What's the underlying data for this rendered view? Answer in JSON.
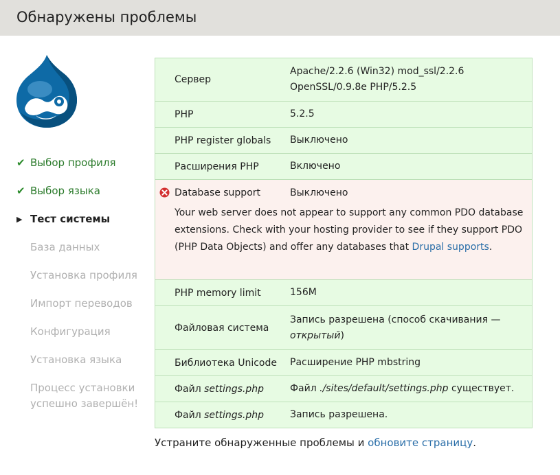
{
  "header": {
    "title": "Обнаружены проблемы"
  },
  "steps": [
    {
      "label": "Выбор профиля",
      "state": "done"
    },
    {
      "label": "Выбор языка",
      "state": "done"
    },
    {
      "label": "Тест системы",
      "state": "active"
    },
    {
      "label": "База данных",
      "state": "pending"
    },
    {
      "label": "Установка профиля",
      "state": "pending"
    },
    {
      "label": "Импорт переводов",
      "state": "pending"
    },
    {
      "label": "Конфигурация",
      "state": "pending"
    },
    {
      "label": "Установка языка",
      "state": "pending"
    },
    {
      "label": "Процесс установки успешно завершён!",
      "state": "pending"
    }
  ],
  "requirements": {
    "server": {
      "label": "Сервер",
      "value": "Apache/2.2.6 (Win32) mod_ssl/2.2.6 OpenSSL/0.9.8e PHP/5.2.5"
    },
    "php": {
      "label": "PHP",
      "value": "5.2.5"
    },
    "register_globals": {
      "label": "PHP register globals",
      "value": "Выключено"
    },
    "extensions": {
      "label": "Расширения PHP",
      "value": "Включено"
    },
    "database": {
      "label": "Database support",
      "value": "Выключено",
      "desc_before": "Your web server does not appear to support any common PDO database extensions. Check with your hosting provider to see if they support PDO (PHP Data Objects) and offer any databases that ",
      "desc_link": "Drupal supports",
      "desc_after": "."
    },
    "memory": {
      "label": "PHP memory limit",
      "value": "156M"
    },
    "filesystem": {
      "label": "Файловая система",
      "value_prefix": "Запись разрешена (способ скачивания — ",
      "value_em": "открытый",
      "value_suffix": ")"
    },
    "unicode": {
      "label": "Библиотека Unicode",
      "value": "Расширение PHP mbstring"
    },
    "settings_file": {
      "label_prefix": "Файл ",
      "label_em": "settings.php",
      "value_prefix": "Файл ",
      "value_em": "./sites/default/settings.php",
      "value_suffix": " существует."
    },
    "settings_write": {
      "label_prefix": "Файл ",
      "label_em": "settings.php",
      "value": "Запись разрешена."
    }
  },
  "footer": {
    "text": "Устраните обнаруженные проблемы и ",
    "link": "обновите страницу",
    "after": "."
  },
  "colors": {
    "ok_bg": "#e7fbe3",
    "error_bg": "#fcf1ee",
    "link": "#2a6ea8",
    "done": "#2a7a2a"
  },
  "icons": {
    "done": "check-icon",
    "active": "triangle-right-icon",
    "error": "error-icon",
    "logo": "drupal-drop-logo"
  }
}
